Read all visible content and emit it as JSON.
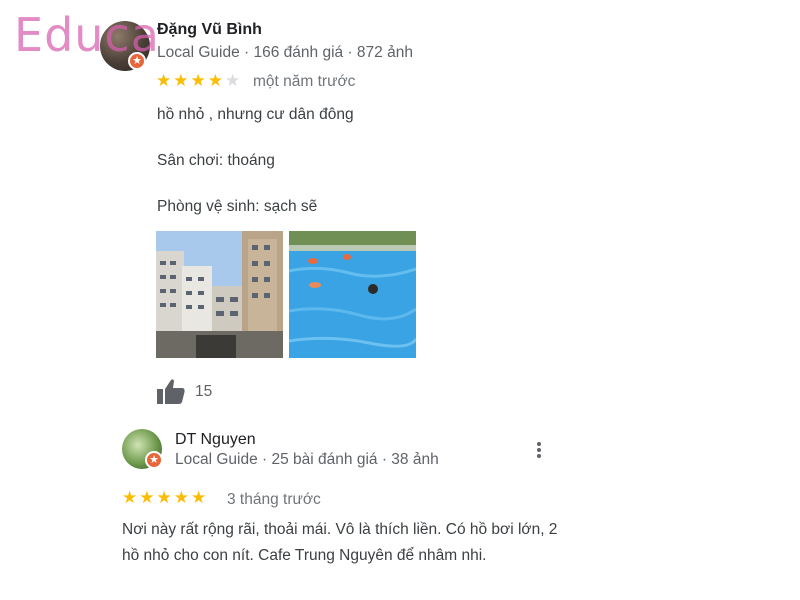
{
  "watermark": "Educa",
  "review1": {
    "author": "Đặng Vũ Bình",
    "meta": "Local Guide · 166 đánh giá · 872 ảnh",
    "rating": 4,
    "max_rating": 5,
    "time": "một năm trước",
    "lines": [
      "hồ nhỏ , nhưng cư dân đông",
      "Sân chơi: thoáng",
      "Phòng vệ sinh: sạch sẽ"
    ],
    "photos": [
      "building-photo",
      "pool-photo"
    ],
    "likes": "15"
  },
  "review2": {
    "author": "DT Nguyen",
    "meta": "Local Guide · 25 bài đánh giá · 38 ảnh",
    "rating": 5,
    "max_rating": 5,
    "time": "3 tháng trước",
    "text": "Nơi này rất rộng rãi, thoải mái. Vô là thích liền. Có hồ bơi lớn, 2 hồ nhỏ cho con nít. Cafe Trung Nguyên để nhâm nhi."
  },
  "colors": {
    "star": "#fbbc04",
    "star_empty": "#dadce0",
    "guide_badge": "#e8663b",
    "watermark": "#d85fb0"
  }
}
